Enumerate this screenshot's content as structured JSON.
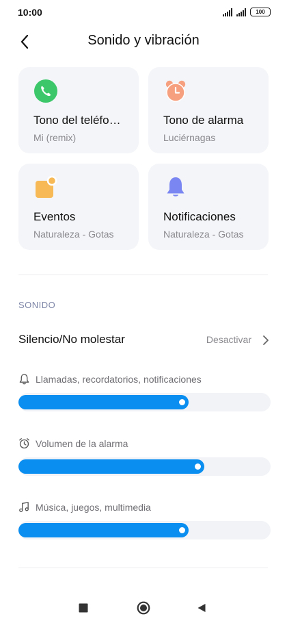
{
  "status_bar": {
    "time": "10:00",
    "battery": "100"
  },
  "header": {
    "title": "Sonido y vibración",
    "back_icon": "chevron-left-icon"
  },
  "cards": [
    {
      "title": "Tono del teléfo…",
      "subtitle": "Mi (remix)",
      "icon": "phone-icon",
      "icon_color": "#3cc76b"
    },
    {
      "title": "Tono de alarma",
      "subtitle": "Luciérnagas",
      "icon": "alarm-clock-icon",
      "icon_color": "#f7a07f"
    },
    {
      "title": "Eventos",
      "subtitle": "Naturaleza - Gotas",
      "icon": "calendar-icon",
      "icon_color": "#f7b955"
    },
    {
      "title": "Notificaciones",
      "subtitle": "Naturaleza - Gotas",
      "icon": "bell-icon",
      "icon_color": "#7a86f2"
    }
  ],
  "sound": {
    "section_label": "SONIDO",
    "silence": {
      "label": "Silencio/No molestar",
      "value": "Desactivar"
    },
    "volumes": [
      {
        "label": "Llamadas, recordatorios, notificaciones",
        "icon": "bell-outline-icon",
        "level": 0.675
      },
      {
        "label": "Volumen de la alarma",
        "icon": "alarm-outline-icon",
        "level": 0.737
      },
      {
        "label": "Música, juegos, multimedia",
        "icon": "music-note-icon",
        "level": 0.675
      }
    ]
  },
  "colors": {
    "accent": "#0a8ef0",
    "card_bg": "#f4f5f8",
    "section_label": "#7e86a8"
  },
  "nav_bar": {
    "icons": [
      "recents-square-icon",
      "home-circle-icon",
      "back-triangle-icon"
    ]
  }
}
